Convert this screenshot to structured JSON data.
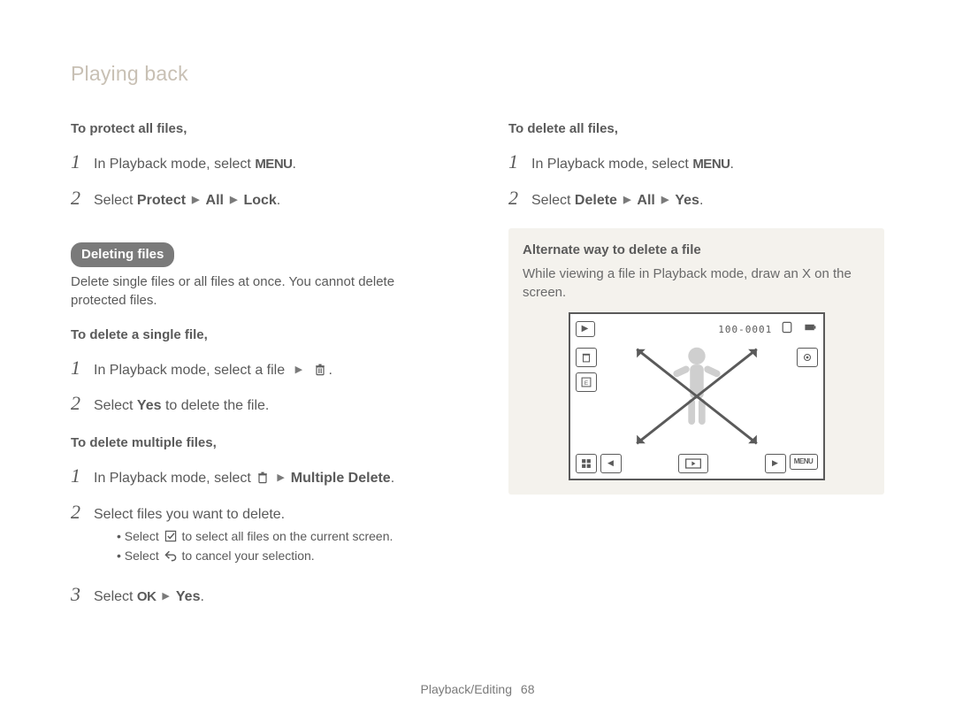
{
  "header": {
    "section_title": "Playing back"
  },
  "left": {
    "protect_all": {
      "heading": "To protect all files,",
      "step1_prefix": "In Playback mode, select ",
      "step1_icon": "MENU",
      "step2_prefix": "Select ",
      "step2_a": "Protect",
      "step2_b": "All",
      "step2_c": "Lock"
    },
    "deleting": {
      "pill": "Deleting files",
      "desc": "Delete single files or all files at once. You cannot delete protected files."
    },
    "single": {
      "heading": "To delete a single file,",
      "step1_prefix": "In Playback mode, select a file ",
      "step2_prefix": "Select ",
      "step2_a": "Yes",
      "step2_suffix": " to delete the file."
    },
    "multiple": {
      "heading": "To delete multiple files,",
      "step1_prefix": "In Playback mode, select ",
      "step1_b": "Multiple Delete",
      "step2": "Select files you want to delete.",
      "bullet1_before": "Select ",
      "bullet1_after": " to select all files on the current screen.",
      "bullet2_before": "Select ",
      "bullet2_after": " to cancel your selection.",
      "step3_prefix": "Select ",
      "step3_a": "OK",
      "step3_b": "Yes"
    }
  },
  "right": {
    "delete_all": {
      "heading": "To delete all files,",
      "step1_prefix": "In Playback mode, select ",
      "step1_icon": "MENU",
      "step2_prefix": "Select ",
      "step2_a": "Delete",
      "step2_b": "All",
      "step2_c": "Yes"
    },
    "alternate": {
      "title": "Alternate way to delete a file",
      "text": "While viewing a file in Playback mode, draw an X on the screen."
    },
    "camera": {
      "counter": "100-0001",
      "menu_label": "MENU"
    }
  },
  "footer": {
    "chapter": "Playback/Editing",
    "page": "68"
  },
  "nums": {
    "1": "1",
    "2": "2",
    "3": "3"
  }
}
